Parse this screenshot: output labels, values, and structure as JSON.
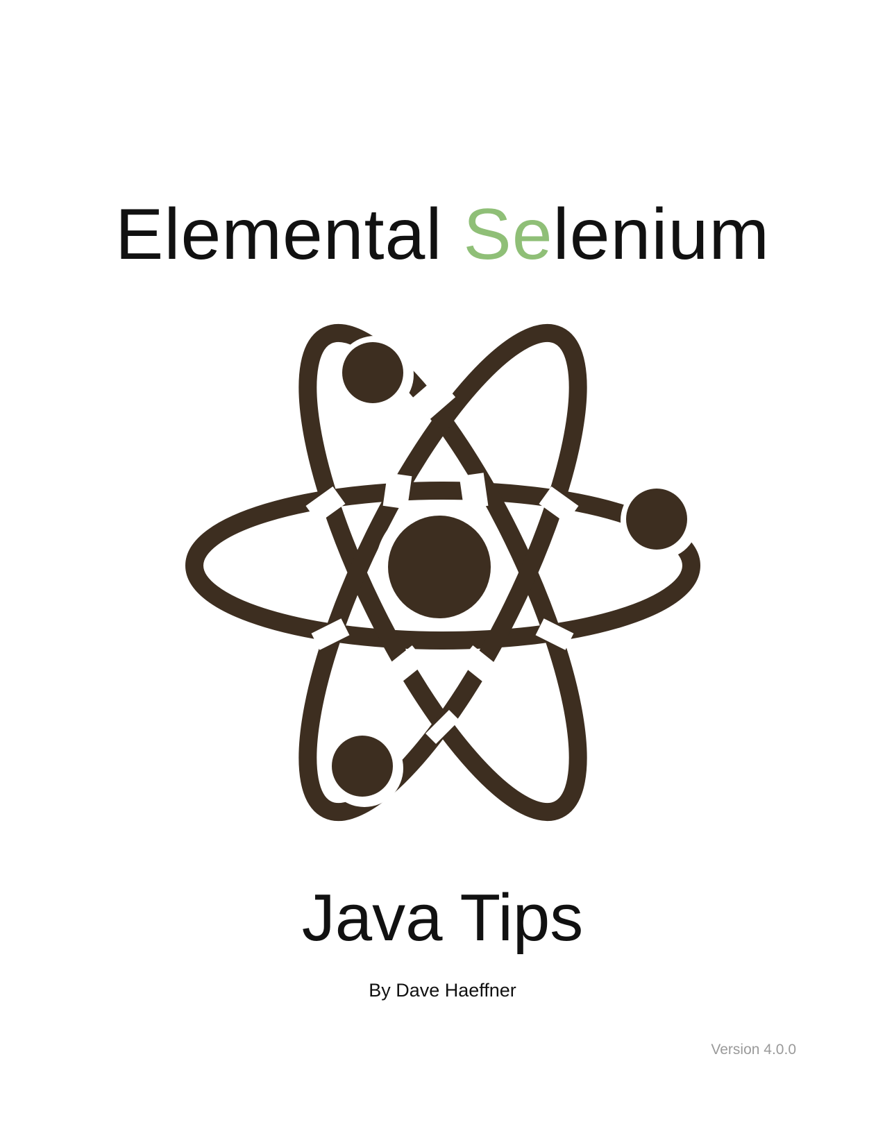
{
  "cover": {
    "title_prefix": "Elemental ",
    "title_accent": "Se",
    "title_suffix": "lenium",
    "book_title": "Java Tips",
    "author": "By Dave Haeffner",
    "version": "Version 4.0.0"
  },
  "colors": {
    "text": "#111111",
    "accent": "#8fbf77",
    "logo": "#3d2e20",
    "version_text": "#9a9a9a",
    "background": "#ffffff"
  },
  "logo": {
    "icon": "atom-icon"
  }
}
